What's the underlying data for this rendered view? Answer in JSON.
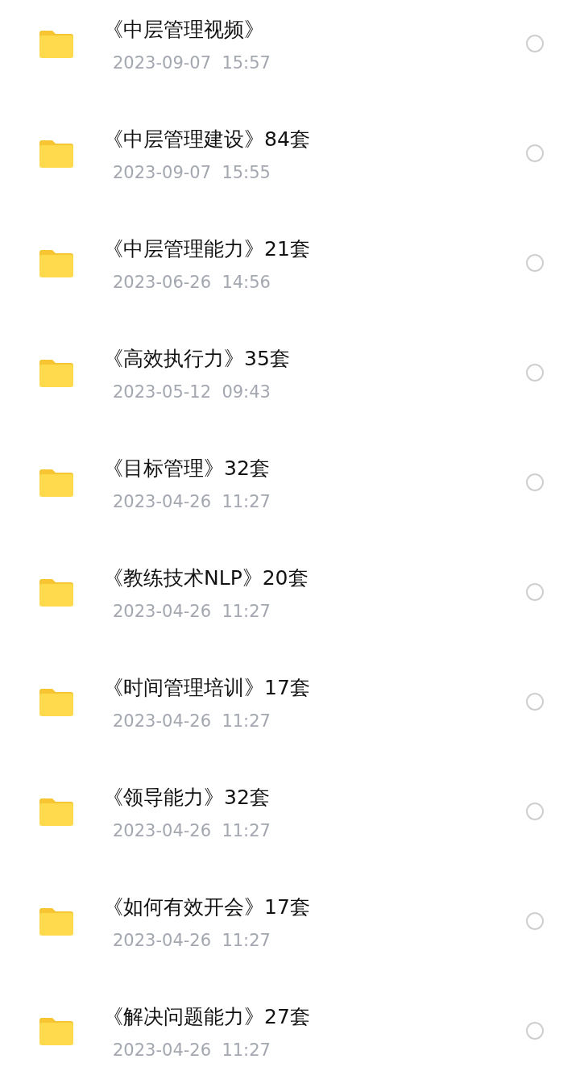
{
  "folders": [
    {
      "name": "《中层管理视频》",
      "modified": "2023-09-07  15:57",
      "selected": false
    },
    {
      "name": "《中层管理建设》84套",
      "modified": "2023-09-07  15:55",
      "selected": false
    },
    {
      "name": "《中层管理能力》21套",
      "modified": "2023-06-26  14:56",
      "selected": false
    },
    {
      "name": "《高效执行力》35套",
      "modified": "2023-05-12  09:43",
      "selected": false
    },
    {
      "name": "《目标管理》32套",
      "modified": "2023-04-26  11:27",
      "selected": false
    },
    {
      "name": "《教练技术NLP》20套",
      "modified": "2023-04-26  11:27",
      "selected": false
    },
    {
      "name": "《时间管理培训》17套",
      "modified": "2023-04-26  11:27",
      "selected": false
    },
    {
      "name": "《领导能力》32套",
      "modified": "2023-04-26  11:27",
      "selected": false
    },
    {
      "name": "《如何有效开会》17套",
      "modified": "2023-04-26  11:27",
      "selected": false
    },
    {
      "name": "《解决问题能力》27套",
      "modified": "2023-04-26  11:27",
      "selected": false
    }
  ]
}
